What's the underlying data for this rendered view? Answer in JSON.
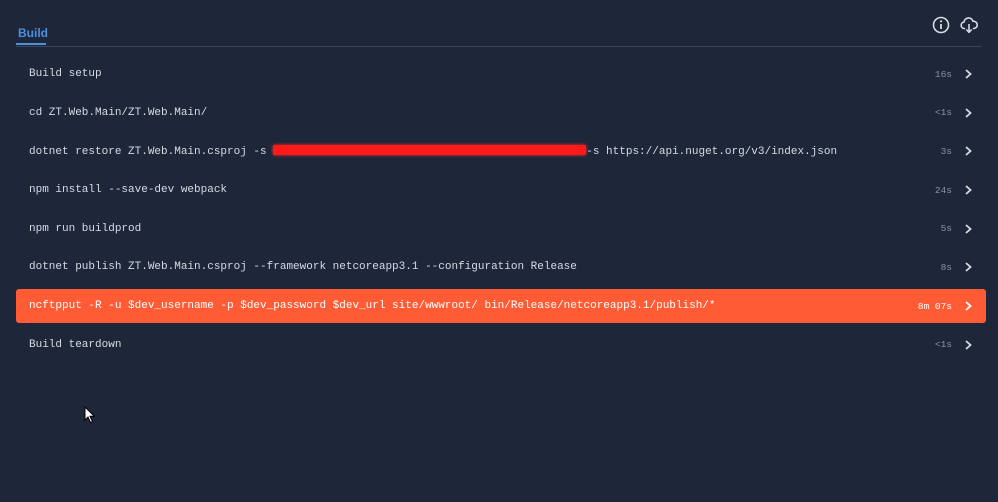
{
  "tabs": {
    "active_label": "Build"
  },
  "icons": {
    "info": "info-icon",
    "download": "cloud-download-icon",
    "chevron": "chevron-right-icon"
  },
  "colors": {
    "background": "#1e2739",
    "accent": "#4a8fe0",
    "failed": "#ff5b35",
    "redaction": "#ff1a1a"
  },
  "steps": [
    {
      "command": "Build setup",
      "duration": "16s",
      "status": "normal"
    },
    {
      "command": "cd ZT.Web.Main/ZT.Web.Main/",
      "duration": "<1s",
      "status": "normal"
    },
    {
      "command_before": "dotnet restore ZT.Web.Main.csproj -s ",
      "command_after": "-s https://api.nuget.org/v3/index.json",
      "duration": "3s",
      "status": "normal",
      "redacted": true
    },
    {
      "command": "npm install --save-dev webpack",
      "duration": "24s",
      "status": "normal"
    },
    {
      "command": "npm run buildprod",
      "duration": "5s",
      "status": "normal"
    },
    {
      "command": "dotnet publish ZT.Web.Main.csproj --framework netcoreapp3.1 --configuration Release",
      "duration": "8s",
      "status": "normal"
    },
    {
      "command": "ncftpput -R -u $dev_username -p $dev_password $dev_url site/wwwroot/ bin/Release/netcoreapp3.1/publish/*",
      "duration": "8m 07s",
      "status": "failed"
    },
    {
      "command": "Build teardown",
      "duration": "<1s",
      "status": "normal"
    }
  ]
}
